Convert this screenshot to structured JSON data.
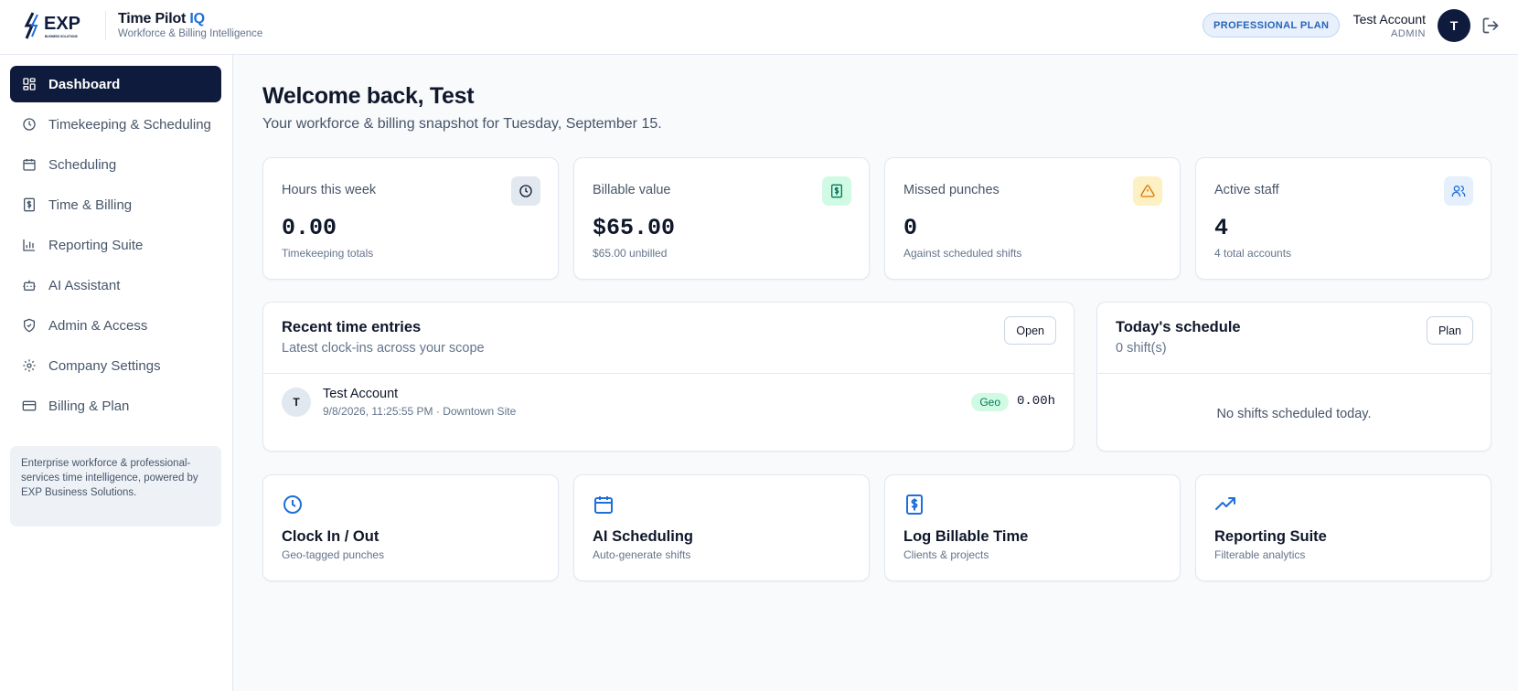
{
  "header": {
    "logo_text": "EXP",
    "logo_subtext": "BUSINESS SOLUTIONS",
    "app_title": "Time Pilot",
    "app_title_accent": "IQ",
    "app_subtitle": "Workforce & Billing Intelligence",
    "plan_badge": "PROFESSIONAL PLAN",
    "user_name": "Test Account",
    "user_role": "ADMIN",
    "avatar_initial": "T",
    "logout_icon": "logout-icon"
  },
  "sidebar": {
    "items": [
      {
        "label": "Dashboard",
        "icon": "dashboard-icon",
        "active": true
      },
      {
        "label": "Timekeeping & Scheduling",
        "icon": "clock-icon"
      },
      {
        "label": "Scheduling",
        "icon": "calendar-icon"
      },
      {
        "label": "Time & Billing",
        "icon": "dollar-receipt-icon"
      },
      {
        "label": "Reporting Suite",
        "icon": "bar-chart-icon"
      },
      {
        "label": "AI Assistant",
        "icon": "bot-icon"
      },
      {
        "label": "Admin & Access",
        "icon": "shield-icon"
      },
      {
        "label": "Company Settings",
        "icon": "gear-icon"
      },
      {
        "label": "Billing & Plan",
        "icon": "credit-card-icon"
      }
    ],
    "note": "Enterprise workforce & professional-services time intelligence, powered by EXP Business Solutions."
  },
  "main": {
    "welcome": "Welcome back, Test",
    "snapshot": "Your workforce & billing snapshot for Tuesday, September 15.",
    "stats": [
      {
        "label": "Hours this week",
        "value": "0.00",
        "sub": "Timekeeping totals",
        "icon": "clock-icon"
      },
      {
        "label": "Billable value",
        "value": "$65.00",
        "sub": "$65.00 unbilled",
        "icon": "dollar-receipt-icon"
      },
      {
        "label": "Missed punches",
        "value": "0",
        "sub": "Against scheduled shifts",
        "icon": "warning-icon"
      },
      {
        "label": "Active staff",
        "value": "4",
        "sub": "4 total accounts",
        "icon": "users-icon"
      }
    ],
    "recent_entries": {
      "title": "Recent time entries",
      "subtitle": "Latest clock-ins across your scope",
      "button": "Open",
      "entries": [
        {
          "initial": "T",
          "name": "Test Account",
          "meta": "9/8/2026, 11:25:55 PM · Downtown Site",
          "badge": "Geo",
          "hours": "0.00h"
        }
      ]
    },
    "schedule": {
      "title": "Today's schedule",
      "subtitle": "0 shift(s)",
      "button": "Plan",
      "empty": "No shifts scheduled today."
    },
    "quick_actions": [
      {
        "title": "Clock In / Out",
        "sub": "Geo-tagged punches",
        "icon": "clock-icon"
      },
      {
        "title": "AI Scheduling",
        "sub": "Auto-generate shifts",
        "icon": "calendar-icon"
      },
      {
        "title": "Log Billable Time",
        "sub": "Clients & projects",
        "icon": "dollar-receipt-icon"
      },
      {
        "title": "Reporting Suite",
        "sub": "Filterable analytics",
        "icon": "trending-up-icon"
      }
    ]
  },
  "colors": {
    "navy": "#0f1b3d",
    "accent_blue": "#1e6fd9",
    "green_bg": "#d1fae5",
    "green": "#047857",
    "amber_bg": "#fdf0c2",
    "amber": "#d97706",
    "blue_bg": "#e6effc"
  }
}
